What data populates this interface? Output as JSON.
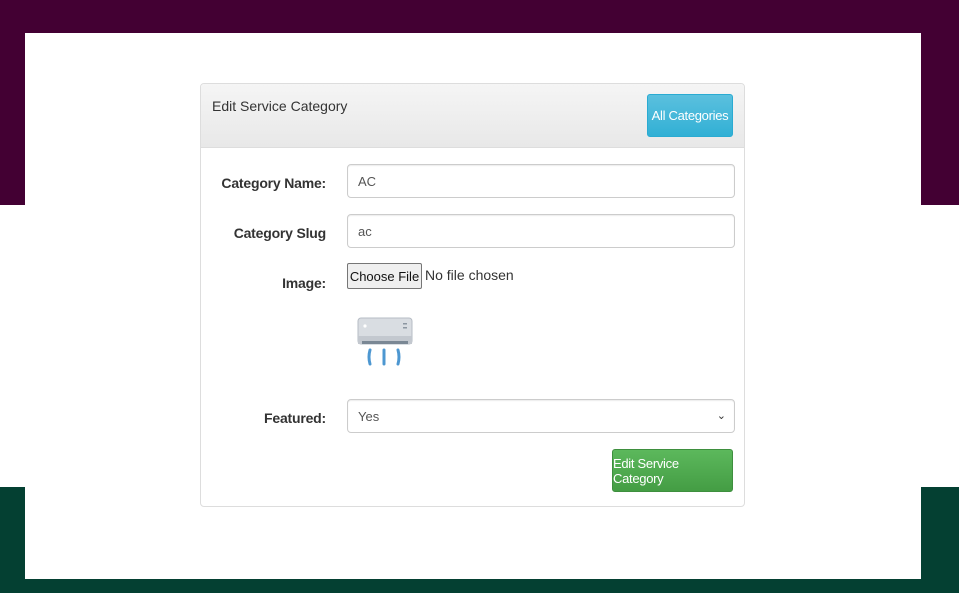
{
  "panel": {
    "title": "Edit Service Category",
    "all_categories_button": "All Categories"
  },
  "form": {
    "name_label": "Category Name:",
    "name_value": "AC",
    "slug_label": "Category Slug",
    "slug_value": "ac",
    "image_label": "Image:",
    "choose_file_button": "Choose File",
    "file_status": "No file chosen",
    "featured_label": "Featured:",
    "featured_value": "Yes",
    "submit_button": "Edit Service Category"
  },
  "colors": {
    "top_band": "#430033",
    "bottom_band": "#044032",
    "info_button": "#5bc0de",
    "success_button": "#5cb85c"
  },
  "icons": {
    "image_preview": "air-conditioner-icon",
    "select_caret": "chevron-down-icon"
  }
}
